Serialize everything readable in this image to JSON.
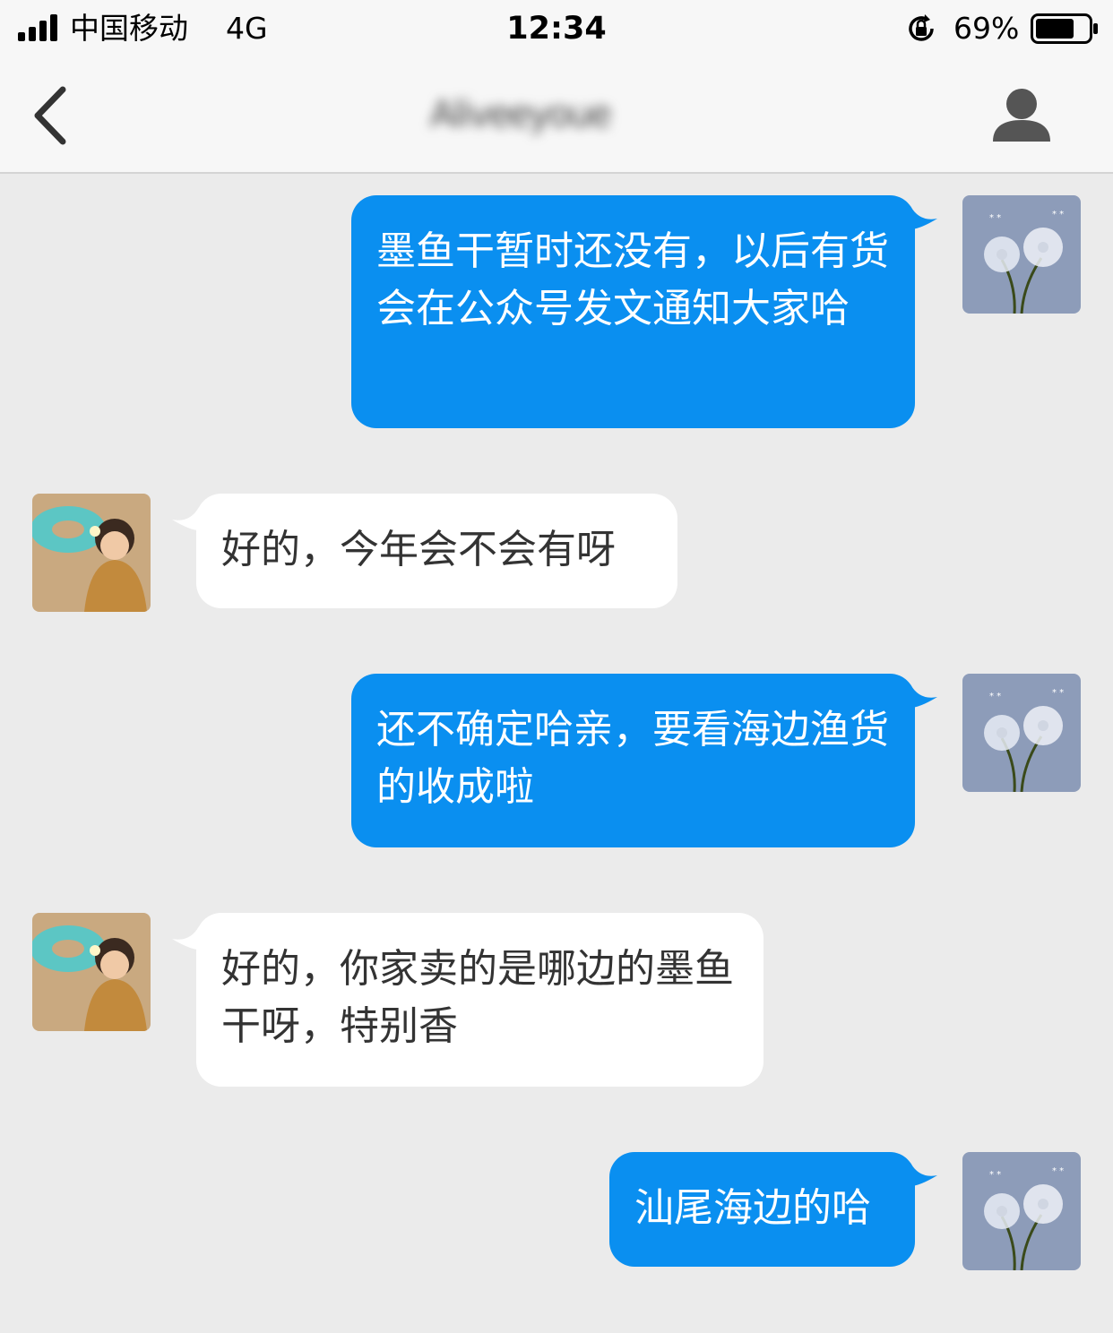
{
  "status_bar": {
    "carrier": "中国移动",
    "network": "4G",
    "time": "12:34",
    "battery": "69%"
  },
  "nav": {
    "title": "Aliveeyoue"
  },
  "messages": [
    {
      "direction": "outgoing",
      "text": "墨鱼干暂时还没有，以后有货会在公众号发文通知大家哈"
    },
    {
      "direction": "incoming",
      "text": "好的，今年会不会有呀"
    },
    {
      "direction": "outgoing",
      "text": "还不确定哈亲，要看海边渔货的收成啦"
    },
    {
      "direction": "incoming",
      "text": "好的，你家卖的是哪边的墨鱼干呀，特别香"
    },
    {
      "direction": "outgoing",
      "text": "汕尾海边的哈"
    }
  ],
  "colors": {
    "outgoing_bubble": "#0a8ff0",
    "incoming_bubble": "#ffffff",
    "background": "#ebebeb"
  }
}
